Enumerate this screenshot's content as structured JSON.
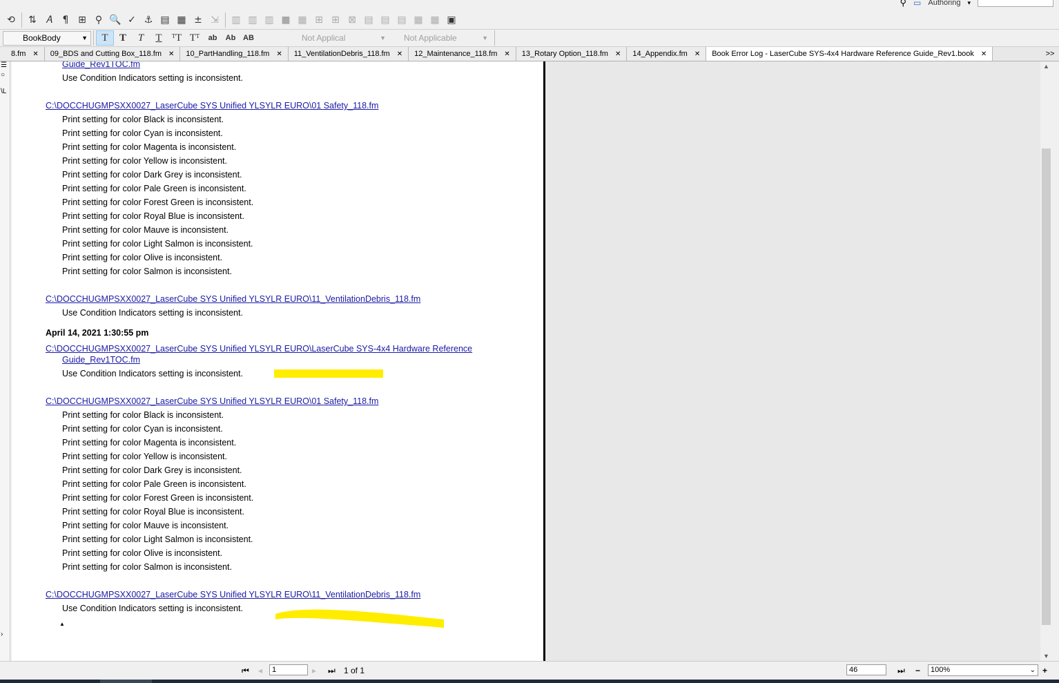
{
  "top": {
    "authoring_label": "Authoring"
  },
  "toolbar2": {
    "paragraph_format": "BookBody",
    "fmt_buttons": [
      "T",
      "T",
      "T",
      "T",
      "ᵀT",
      "Tᵀ",
      "ab",
      "Ab",
      "AB"
    ],
    "condition1": "Not Applical",
    "condition2": "Not Applicable"
  },
  "tabs": [
    {
      "label": "8.fm",
      "close": "✕"
    },
    {
      "label": "09_BDS and Cutting Box_118.fm",
      "close": "✕"
    },
    {
      "label": "10_PartHandling_118.fm",
      "close": "✕"
    },
    {
      "label": "11_VentilationDebris_118.fm",
      "close": "✕"
    },
    {
      "label": "12_Maintenance_118.fm",
      "close": "✕"
    },
    {
      "label": "13_Rotary Option_118.fm",
      "close": "✕"
    },
    {
      "label": "14_Appendix.fm",
      "close": "✕"
    },
    {
      "label": "Book Error Log - LaserCube SYS-4x4 Hardware Reference Guide_Rev1.book",
      "close": "✕"
    }
  ],
  "tabs_more": ">>",
  "doc": {
    "partial_link": "Guide_Rev1TOC.fm",
    "use_condition_msg": "Use Condition Indicators setting is inconsistent.",
    "safety_link": "C:\\DOCCHUGMPSXX0027_LaserCube SYS Unified YLSYLR EURO\\01 Safety_118.fm",
    "vent_link": "C:\\DOCCHUGMPSXX0027_LaserCube SYS Unified YLSYLR EURO\\11_VentilationDebris_118.fm",
    "toc_link_line1": "C:\\DOCCHUGMPSXX0027_LaserCube SYS Unified YLSYLR EURO\\LaserCube SYS-4x4 Hardware Reference",
    "toc_link_line2": "Guide_Rev1TOC.fm",
    "timestamp": "April 14, 2021 1:30:55 pm",
    "color_messages": [
      "Print setting for color Black is inconsistent.",
      "Print setting for color Cyan is inconsistent.",
      "Print setting for color Magenta is inconsistent.",
      "Print setting for color Yellow is inconsistent.",
      "Print setting for color Dark Grey is inconsistent.",
      "Print setting for color Pale Green is inconsistent.",
      "Print setting for color Forest Green is inconsistent.",
      "Print setting for color Royal Blue is inconsistent.",
      "Print setting for color Mauve is inconsistent.",
      "Print setting for color Light Salmon is inconsistent.",
      "Print setting for color Olive is inconsistent.",
      "Print setting for color Salmon is inconsistent."
    ]
  },
  "status": {
    "page_value": "1",
    "page_count": "1 of 1",
    "zoom_field": "46",
    "zoom_select": "100%"
  },
  "colors": {
    "highlight": "#ffed00",
    "link": "#1a1aa6",
    "active_button": "#cce4f7"
  }
}
